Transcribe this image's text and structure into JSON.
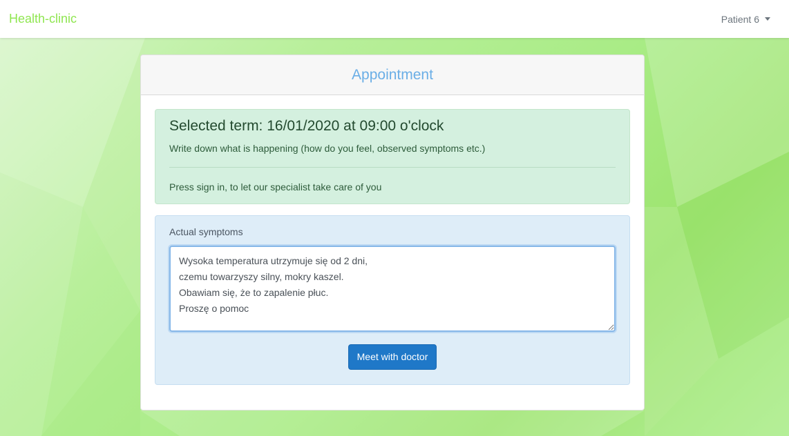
{
  "navbar": {
    "brand": "Health-clinic",
    "user_label": "Patient 6",
    "caret_icon": "caret-down-icon"
  },
  "card": {
    "title": "Appointment"
  },
  "alert": {
    "heading": "Selected term: 16/01/2020 at 09:00 o'clock",
    "text": "Write down what is happening (how do you feel, observed symptoms etc.)",
    "footer": "Press sign in, to let our specialist take care of you"
  },
  "form": {
    "label": "Actual symptoms",
    "textarea_value": "Wysoka temperatura utrzymuje się od 2 dni,\nczemu towarzyszy silny, mokry kaszel.\nObawiam się, że to zapalenie płuc.\nProszę o pomoc",
    "submit_label": "Meet with doctor"
  },
  "colors": {
    "brand": "#8fe650",
    "title": "#6aaee6",
    "button": "#1f78c8",
    "alert_bg": "#d4f0df",
    "form_bg": "#deedf8"
  }
}
